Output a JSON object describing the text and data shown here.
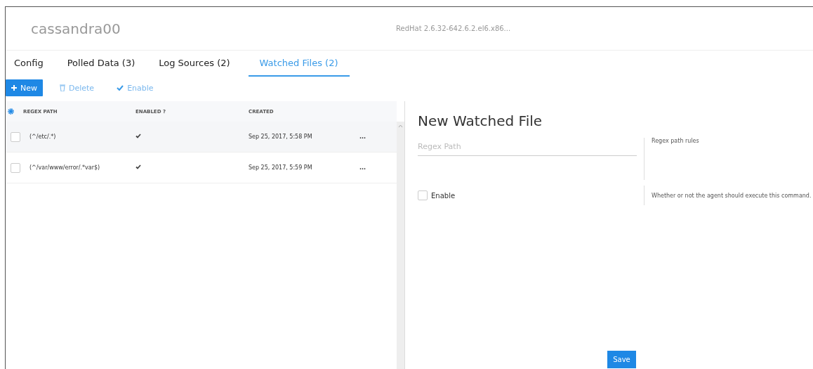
{
  "header": {
    "title": "cassandra00",
    "subtitle": "RedHat 2.6.32-642.6.2.el6.x86..."
  },
  "tabs": [
    {
      "label": "Config",
      "selected": false
    },
    {
      "label": "Polled Data (3)",
      "selected": false
    },
    {
      "label": "Log Sources (2)",
      "selected": false
    },
    {
      "label": "Watched Files (2)",
      "selected": true
    }
  ],
  "toolbar": {
    "new": "New",
    "delete": "Delete",
    "enable": "Enable"
  },
  "table": {
    "columns": [
      "REGEX PATH",
      "ENABLED ?",
      "CREATED"
    ],
    "rows": [
      {
        "checked": false,
        "path": "(^/etc/.*)",
        "enabled": true,
        "created": "Sep 25, 2017, 5:58 PM",
        "menu": "..."
      },
      {
        "checked": false,
        "path": "(^/var/www/error/.*var$)",
        "enabled": true,
        "created": "Sep 25, 2017, 5:59 PM",
        "menu": "..."
      }
    ]
  },
  "form": {
    "title": "New Watched File",
    "field": {
      "placeholder": "Regex Path",
      "help": "Regex path rules"
    },
    "enable": {
      "label": "Enable",
      "checked": false,
      "help": "Whether or not the agent should execute this command."
    },
    "save": "Save"
  }
}
